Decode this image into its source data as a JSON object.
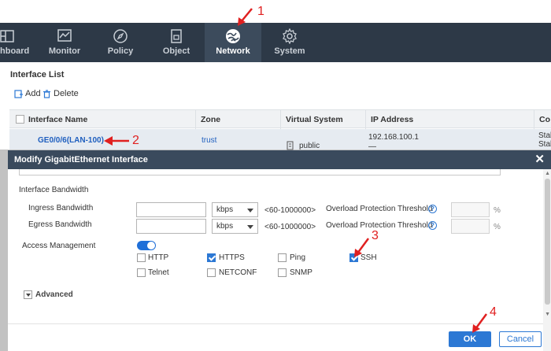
{
  "nav": {
    "items": [
      {
        "label": "hboard",
        "icon": "dashboard-icon"
      },
      {
        "label": "Monitor",
        "icon": "monitor-icon"
      },
      {
        "label": "Policy",
        "icon": "policy-icon"
      },
      {
        "label": "Object",
        "icon": "object-icon"
      },
      {
        "label": "Network",
        "icon": "network-icon",
        "active": true
      },
      {
        "label": "System",
        "icon": "gear-icon"
      }
    ]
  },
  "interface_list": {
    "title": "Interface List",
    "add_label": "Add",
    "delete_label": "Delete",
    "columns": [
      "Interface Name",
      "Zone",
      "Virtual System",
      "IP Address",
      "Co"
    ],
    "row": {
      "name": "GE0/0/6(LAN-100)",
      "zone": "trust",
      "virtual_system": "public",
      "ip_line1": "192.168.100.1",
      "ip_line2": "—",
      "status_line1": "Stal",
      "status_line2": "Stal"
    }
  },
  "dialog": {
    "title": "Modify GigabitEthernet Interface",
    "close": "✕",
    "section_bandwidth": "Interface Bandwidth",
    "ingress_label": "Ingress Bandwidth",
    "egress_label": "Egress Bandwidth",
    "unit_value": "kbps",
    "range_text": "<60-1000000>",
    "overload_label": "Overload Protection Threshold",
    "percent": "%",
    "help": "?",
    "access_label": "Access Management",
    "access_enabled": true,
    "services": [
      {
        "label": "HTTP",
        "checked": false
      },
      {
        "label": "HTTPS",
        "checked": true
      },
      {
        "label": "Ping",
        "checked": false
      },
      {
        "label": "SSH",
        "checked": true
      },
      {
        "label": "Telnet",
        "checked": false
      },
      {
        "label": "NETCONF",
        "checked": false
      },
      {
        "label": "SNMP",
        "checked": false
      }
    ],
    "advanced_label": "Advanced",
    "ok_label": "OK",
    "cancel_label": "Cancel"
  },
  "callouts": [
    "1",
    "2",
    "3",
    "4"
  ],
  "colors": {
    "topbar": "#2d3947",
    "accent": "#2c78d4",
    "callout": "#e02020"
  }
}
